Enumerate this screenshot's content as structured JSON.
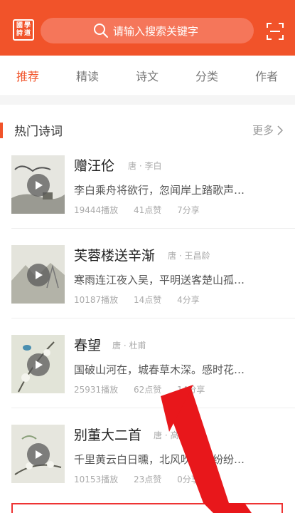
{
  "header": {
    "logo_chars": [
      "國",
      "詩",
      "學",
      "道"
    ],
    "search_placeholder": "请输入搜索关键字",
    "accent": "#f1532a"
  },
  "tabs": [
    {
      "label": "推荐",
      "active": true
    },
    {
      "label": "精读",
      "active": false
    },
    {
      "label": "诗文",
      "active": false
    },
    {
      "label": "分类",
      "active": false
    },
    {
      "label": "作者",
      "active": false
    }
  ],
  "section": {
    "title": "热门诗词",
    "more": "更多"
  },
  "poems": [
    {
      "title": "赠汪伦",
      "author": "唐 · 李白",
      "excerpt": "李白乘舟将欲行，忽闻岸上踏歌声…",
      "plays": "19444播放",
      "likes": "41点赞",
      "shares": "7分享"
    },
    {
      "title": "芙蓉楼送辛渐",
      "author": "唐 · 王昌龄",
      "excerpt": "寒雨连江夜入吴，平明送客楚山孤…",
      "plays": "10187播放",
      "likes": "14点赞",
      "shares": "4分享"
    },
    {
      "title": "春望",
      "author": "唐 · 杜甫",
      "excerpt": "国破山河在，城春草木深。感时花…",
      "plays": "25931播放",
      "likes": "62点赞",
      "shares": "14分享"
    },
    {
      "title": "别董大二首",
      "author": "唐 · 高适",
      "excerpt": "千里黄云白日曛，北风吹雁雪纷纷…",
      "plays": "10153播放",
      "likes": "23点赞",
      "shares": "0分享"
    }
  ]
}
